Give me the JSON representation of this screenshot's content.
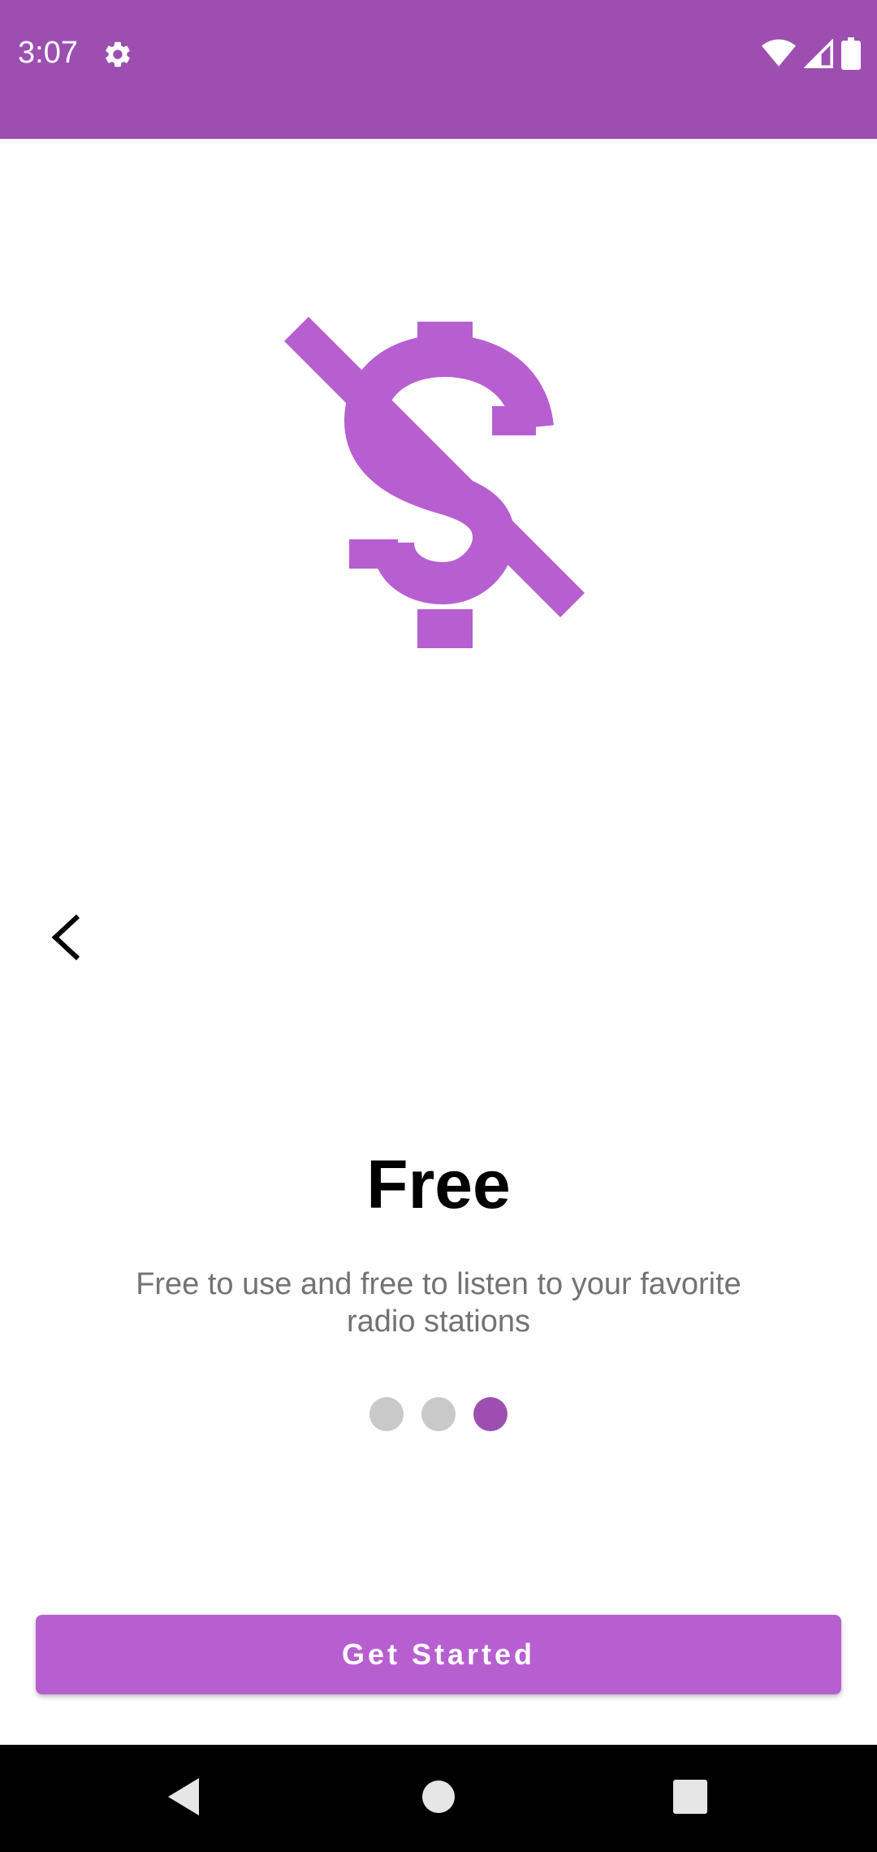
{
  "status_bar": {
    "time": "3:07",
    "background": "#9c4fb1",
    "icons": [
      "settings-icon",
      "wifi-icon",
      "cell-signal-icon",
      "battery-icon"
    ]
  },
  "onboarding": {
    "hero_icon": "money-off-icon",
    "hero_color": "#b75fd1",
    "back_icon": "chevron-left-icon",
    "title": "Free",
    "description": "Free to use and free to listen to your favorite radio stations",
    "page_indicator": {
      "total": 3,
      "active_index": 2,
      "active_color": "#9c4fb1",
      "inactive_color": "#c9c9c9"
    },
    "cta_label": "Get Started",
    "cta_color": "#b75fd1"
  },
  "nav_bar": {
    "buttons": [
      "back-triangle-icon",
      "home-circle-icon",
      "recents-square-icon"
    ]
  }
}
